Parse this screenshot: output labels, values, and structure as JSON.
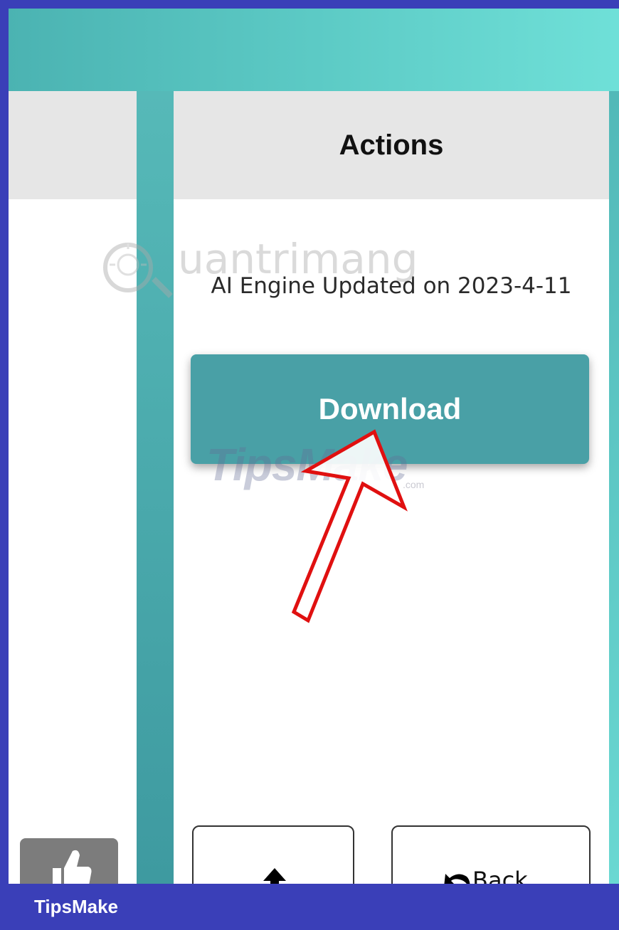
{
  "actions_panel": {
    "title": "Actions",
    "engine_text": "AI Engine Updated on 2023-4-11",
    "download_label": "Download",
    "back_label": "Back"
  },
  "icons": {
    "like": "thumbs-up-icon",
    "upload": "arrow-up-icon",
    "back": "undo-arrow-icon"
  },
  "watermarks": {
    "site_text": "uantrimang",
    "tips_text": "TipsMake",
    "tips_suffix": ".com"
  },
  "annotation": {
    "arrow_color": "#e01010"
  },
  "brand_bar": {
    "label": "TipsMake",
    "color": "#3a3fb8"
  },
  "colors": {
    "accent_teal": "#49a0a6",
    "header_gray": "#e6e6e6"
  }
}
